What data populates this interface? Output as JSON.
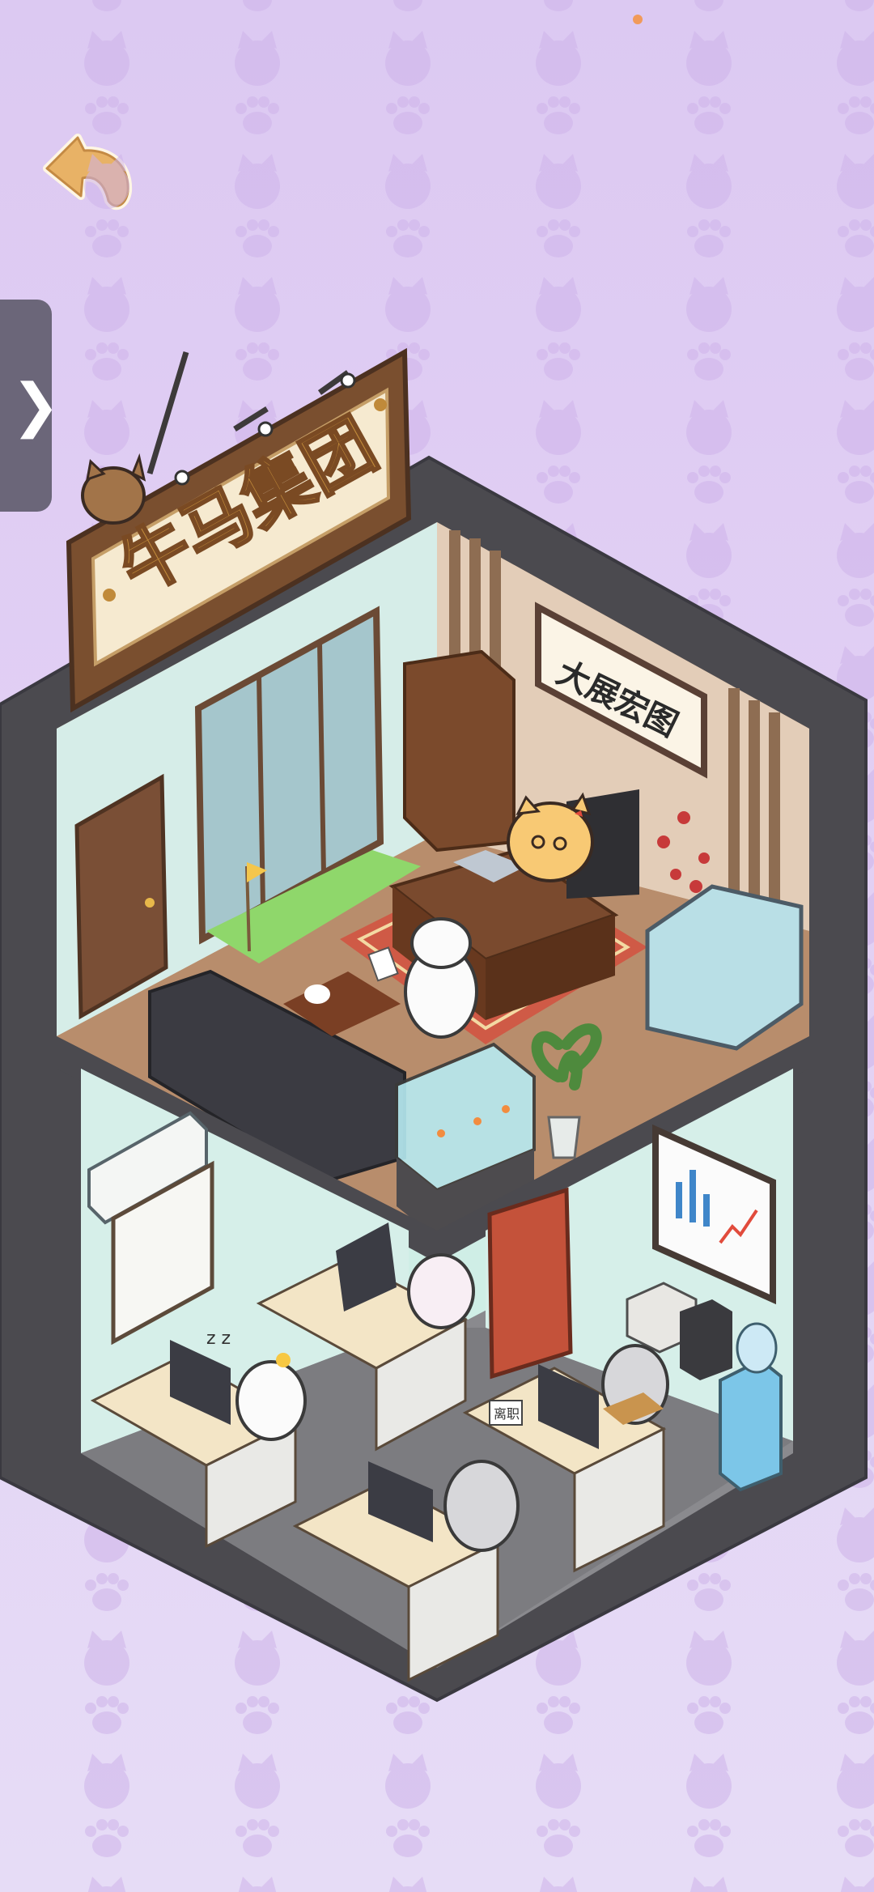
{
  "status": {
    "indicator_color": "#f19a5a"
  },
  "navigation": {
    "back_icon": "back-arrow-paw-icon",
    "side_tab_icon": "chevron-right-icon",
    "side_tab_label": "❯"
  },
  "building": {
    "company_sign": "牛马集团",
    "office_banner": "大展宏图",
    "memo_note": "离职"
  },
  "colors": {
    "background": "#dcc9f2",
    "wall_frame": "#4b4a4f",
    "sign_wood": "#7a4f2f",
    "sign_face": "#f6ead0",
    "sign_text": "#c08a3a"
  }
}
